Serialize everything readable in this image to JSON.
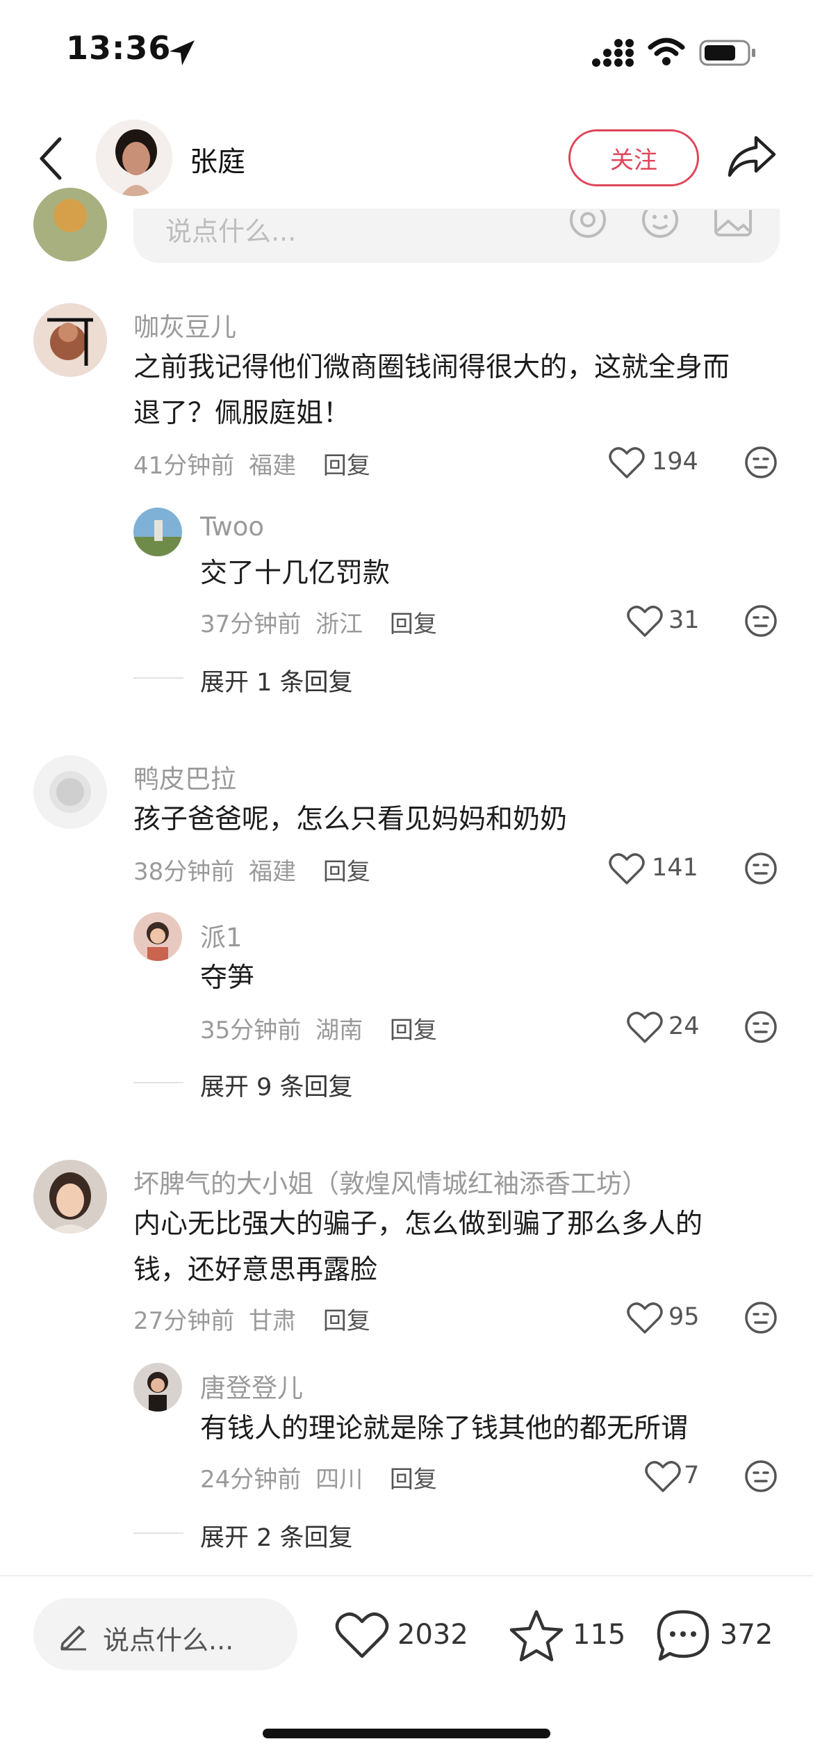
{
  "status_bar": {
    "time": "13:36"
  },
  "header": {
    "author_name": "张庭",
    "follow_label": "关注"
  },
  "compose_top": {
    "placeholder": "说点什么..."
  },
  "comments": [
    {
      "name": "咖灰豆儿",
      "text_line1": "之前我记得他们微商圈钱闹得很大的，这就全身而",
      "text_line2": "退了？佩服庭姐！",
      "time": "41分钟前",
      "region": "福建",
      "reply_label": "回复",
      "likes": "194",
      "reply": {
        "name": "Twoo",
        "text": "交了十几亿罚款",
        "time": "37分钟前",
        "region": "浙江",
        "reply_label": "回复",
        "likes": "31"
      },
      "expand": "展开 1 条回复"
    },
    {
      "name": "鸭皮巴拉",
      "text_line1": "孩子爸爸呢，怎么只看见妈妈和奶奶",
      "time": "38分钟前",
      "region": "福建",
      "reply_label": "回复",
      "likes": "141",
      "reply": {
        "name": "派1",
        "text": "夺笋",
        "time": "35分钟前",
        "region": "湖南",
        "reply_label": "回复",
        "likes": "24"
      },
      "expand": "展开 9 条回复"
    },
    {
      "name": "坏脾气的大小姐（敦煌风情城红袖添香工坊）",
      "text_line1": "内心无比强大的骗子，怎么做到骗了那么多人的",
      "text_line2": "钱，还好意思再露脸",
      "time": "27分钟前",
      "region": "甘肃",
      "reply_label": "回复",
      "likes": "95",
      "reply": {
        "name": "唐登登儿",
        "text": "有钱人的理论就是除了钱其他的都无所谓",
        "time": "24分钟前",
        "region": "四川",
        "reply_label": "回复",
        "likes": "7"
      },
      "expand": "展开 2 条回复"
    }
  ],
  "bottom_bar": {
    "placeholder": "说点什么...",
    "likes": "2032",
    "favorites": "115",
    "comments": "372"
  },
  "colors": {
    "accent": "#e0455a",
    "meta": "#9a9a9a",
    "text": "#1c1c1c"
  },
  "icons": [
    "back-icon",
    "share-icon",
    "at-icon",
    "emoji-icon",
    "image-icon",
    "heart-icon",
    "dislike-icon",
    "edit-icon",
    "star-icon",
    "comment-icon",
    "location-icon"
  ]
}
